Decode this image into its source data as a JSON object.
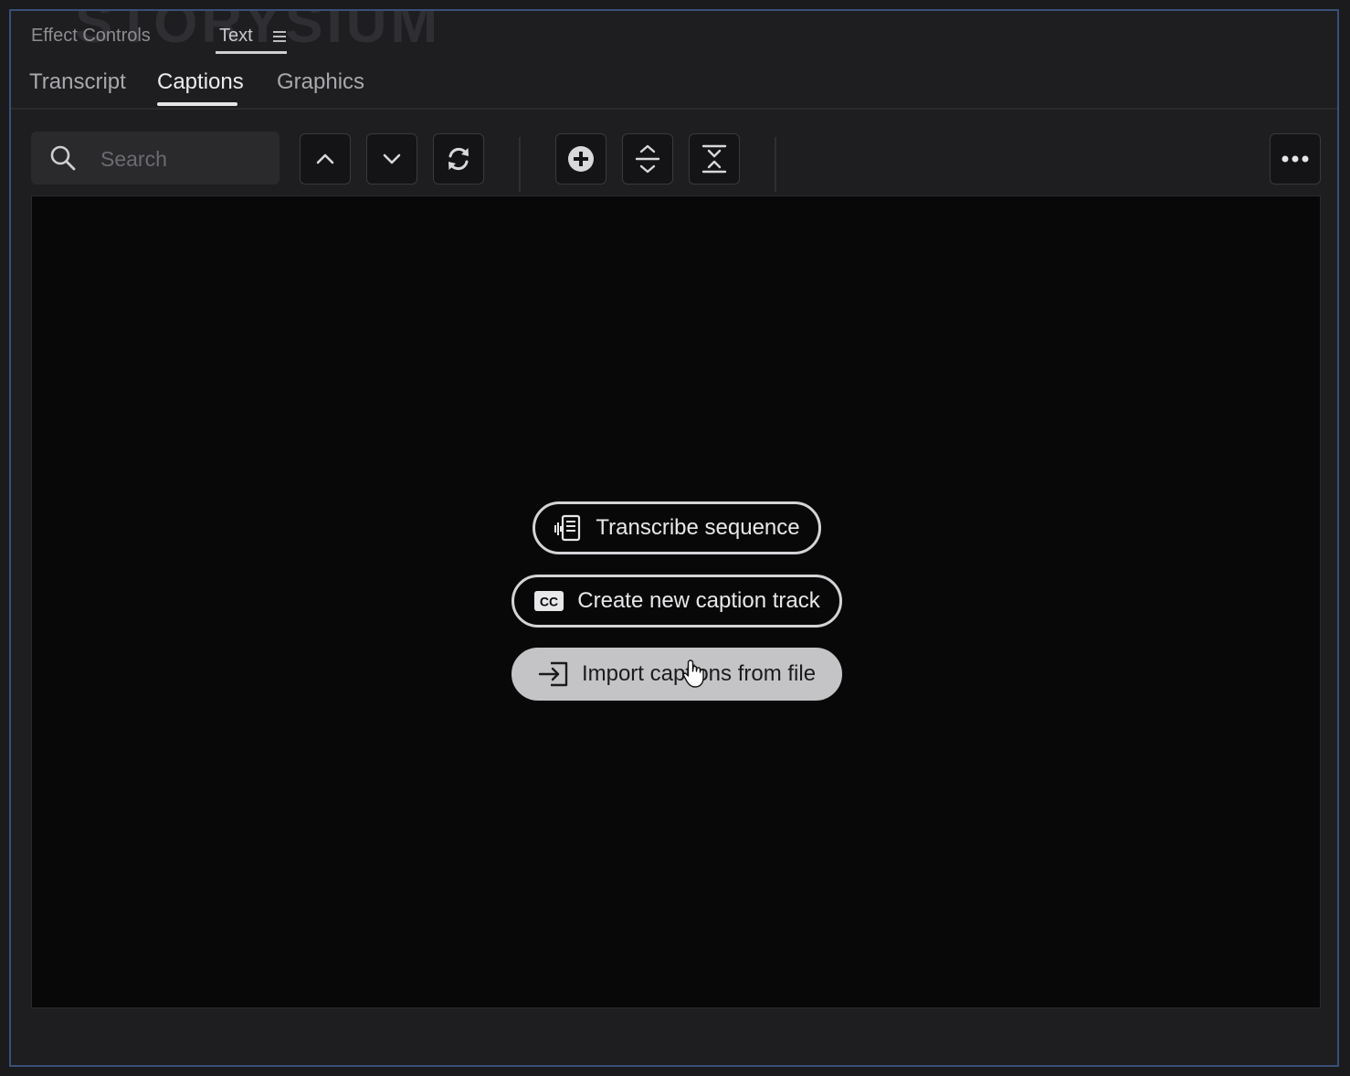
{
  "watermark": "STORYSIUM",
  "panel": {
    "tabs": [
      {
        "label": "Effect Controls",
        "active": false
      },
      {
        "label": "Text",
        "active": true
      }
    ],
    "menu_icon": "hamburger-icon"
  },
  "subtabs": [
    {
      "label": "Transcript",
      "active": false
    },
    {
      "label": "Captions",
      "active": true
    },
    {
      "label": "Graphics",
      "active": false
    }
  ],
  "toolbar": {
    "search_placeholder": "Search",
    "search_value": "",
    "buttons": [
      {
        "icon": "chevron-up-icon"
      },
      {
        "icon": "chevron-down-icon"
      },
      {
        "icon": "refresh-icon"
      },
      {
        "icon": "add-circle-icon"
      },
      {
        "icon": "expand-icon"
      },
      {
        "icon": "collapse-icon"
      },
      {
        "icon": "more-icon"
      }
    ]
  },
  "actions": {
    "transcribe": {
      "label": "Transcribe sequence",
      "icon": "transcribe-icon"
    },
    "create_track": {
      "label": "Create new caption track",
      "icon": "cc-icon"
    },
    "import": {
      "label": "Import captions from file",
      "icon": "import-icon",
      "hovered": true
    }
  },
  "colors": {
    "accent_border": "#3a4f78",
    "panel_bg": "#1e1e20",
    "content_bg": "#080809",
    "button_filled": "#c4c4c7"
  }
}
